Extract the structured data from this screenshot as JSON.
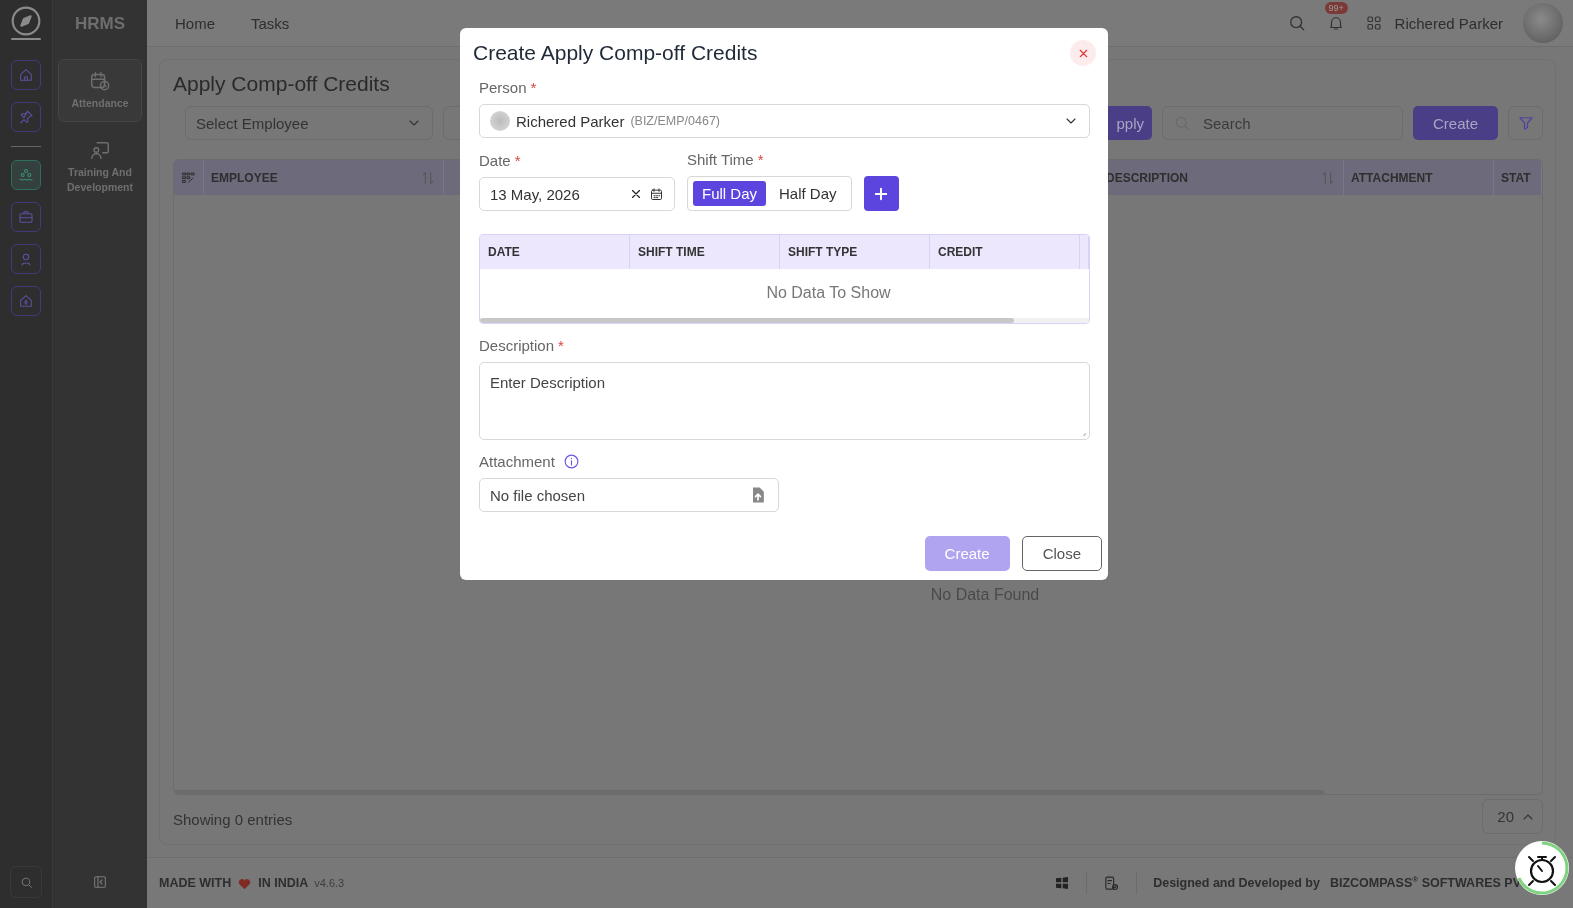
{
  "app_name": "HRMS",
  "rail": {
    "items": [
      {
        "kind": "home",
        "selected": false
      },
      {
        "kind": "pin",
        "selected": false
      },
      {
        "kind": "people",
        "selected": true
      },
      {
        "kind": "briefcase",
        "selected": false
      },
      {
        "kind": "person",
        "selected": false
      },
      {
        "kind": "house",
        "selected": false
      }
    ]
  },
  "sidebar": {
    "items": [
      {
        "label": "Attendance",
        "kind": "calendar",
        "selected": true
      },
      {
        "label": "Training And Development",
        "kind": "trainer",
        "selected": false
      }
    ]
  },
  "topbar": {
    "nav": [
      "Home",
      "Tasks"
    ],
    "notification_badge": "99+",
    "user_name": "Richered Parker"
  },
  "page": {
    "title": "Apply Comp-off Credits",
    "employee_select": {
      "placeholder": "Select Employee"
    },
    "apply_button": "pply",
    "search": {
      "placeholder": "Search"
    },
    "create_button": "Create",
    "table": {
      "columns": [
        {
          "label": "EMPLOYEE",
          "sortable": true
        },
        {
          "label": "DESCRIPTION",
          "sortable": true
        },
        {
          "label": "ATTACHMENT",
          "sortable": false
        },
        {
          "label": "STAT"
        }
      ],
      "empty_message": "No Data Found"
    },
    "entries_text": "Showing 0 entries",
    "page_size": "20"
  },
  "footer": {
    "made_with": "MADE WITH",
    "in_india": "IN INDIA",
    "version": "v4.6.3",
    "credit": "Designed and Developed by",
    "company": "BIZCOMPASS$^{®}$ SOFTWARES PV"
  },
  "modal": {
    "title": "Create Apply Comp-off Credits",
    "person": {
      "label": "Person",
      "required_mark": "*",
      "value": "Richered Parker",
      "code": "(BIZ/EMP/0467)"
    },
    "date": {
      "label": "Date",
      "required_mark": "*",
      "value": "13 May, 2026"
    },
    "shift_time": {
      "label": "Shift Time",
      "required_mark": "*",
      "options": [
        {
          "label": "Full Day",
          "selected": true
        },
        {
          "label": "Half Day",
          "selected": false
        }
      ]
    },
    "grid": {
      "columns": [
        "DATE",
        "SHIFT TIME",
        "SHIFT TYPE",
        "CREDIT"
      ],
      "empty_message": "No Data To Show"
    },
    "description": {
      "label": "Description",
      "required_mark": "*",
      "placeholder": "Enter Description"
    },
    "attachment": {
      "label": "Attachment",
      "value": "No file chosen"
    },
    "buttons": [
      {
        "label": "Create",
        "kind": "primary",
        "disabled": true
      },
      {
        "label": "Close",
        "kind": "secondary",
        "disabled": false
      }
    ]
  }
}
